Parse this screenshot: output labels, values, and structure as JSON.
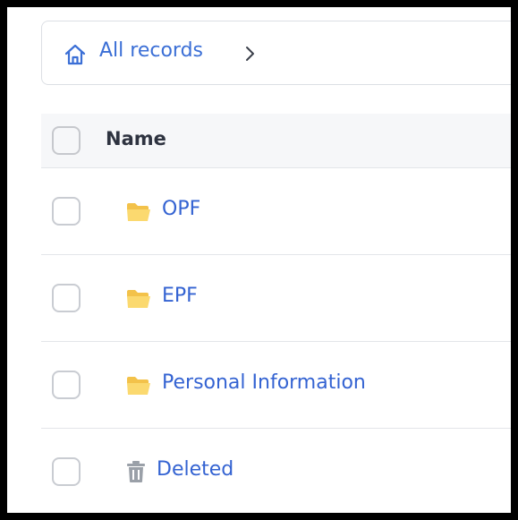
{
  "breadcrumb": {
    "home_icon": "home-icon",
    "root_label": "All records",
    "separator_icon": "chevron-right-icon"
  },
  "table": {
    "header": {
      "name_label": "Name"
    },
    "rows": [
      {
        "icon": "folder-icon",
        "label": "OPF"
      },
      {
        "icon": "folder-icon",
        "label": "EPF"
      },
      {
        "icon": "folder-icon",
        "label": "Personal Information"
      },
      {
        "icon": "trash-icon",
        "label": "Deleted"
      }
    ]
  },
  "colors": {
    "link": "#3463d2",
    "folder": "#f7cf5e",
    "trash": "#9aa0a8",
    "border": "#e3e5e9",
    "header_bg": "#f6f7f9"
  }
}
